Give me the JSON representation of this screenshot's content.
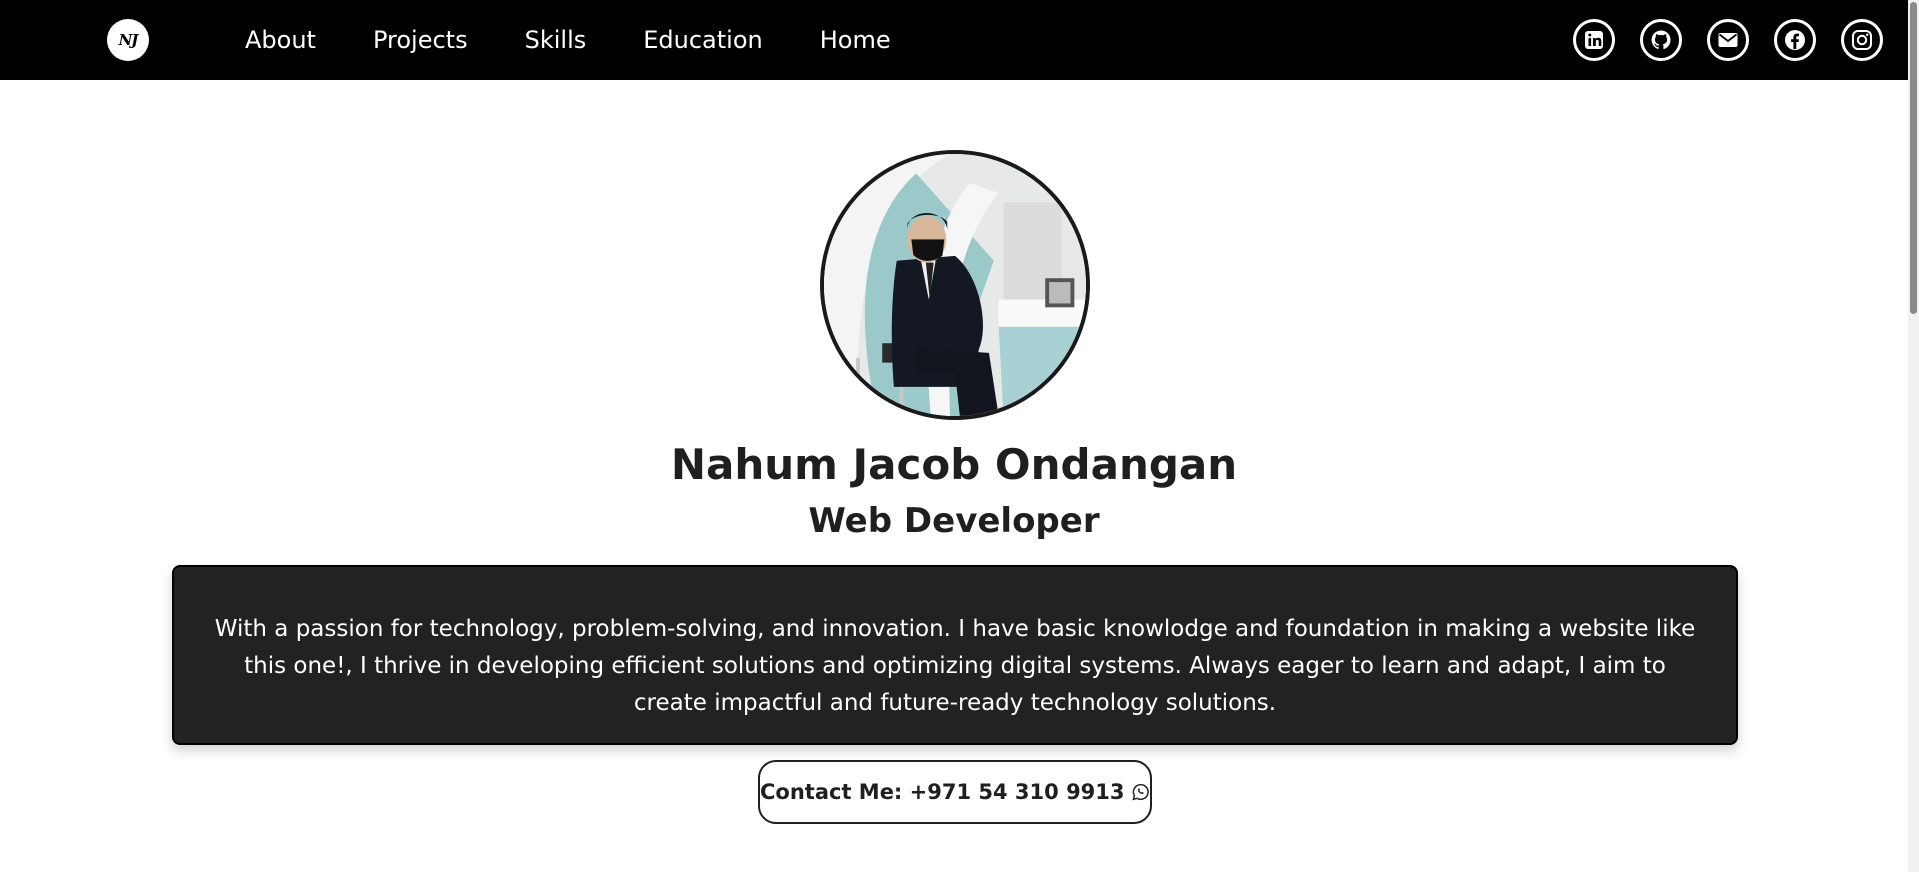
{
  "navbar": {
    "logo_text": "NJ",
    "links": [
      "About",
      "Projects",
      "Skills",
      "Education",
      "Home"
    ],
    "socials": [
      "linkedin-icon",
      "github-icon",
      "mail-icon",
      "facebook-icon",
      "instagram-icon"
    ]
  },
  "profile": {
    "name": "Nahum Jacob Ondangan",
    "role": "Web Developer",
    "bio": "With a passion for technology, problem-solving, and innovation. I have basic knowlodge and foundation in making a website like this one!, I thrive in developing efficient solutions and optimizing digital systems. Always eager to learn and adapt, I aim to create impactful and future-ready technology solutions.",
    "contact_label": "Contact Me: +971 54 310 9913",
    "contact_icon": "whatsapp-icon"
  },
  "colors": {
    "navbar_bg": "#000000",
    "bio_bg": "#222222",
    "text": "#1f1f1f"
  }
}
